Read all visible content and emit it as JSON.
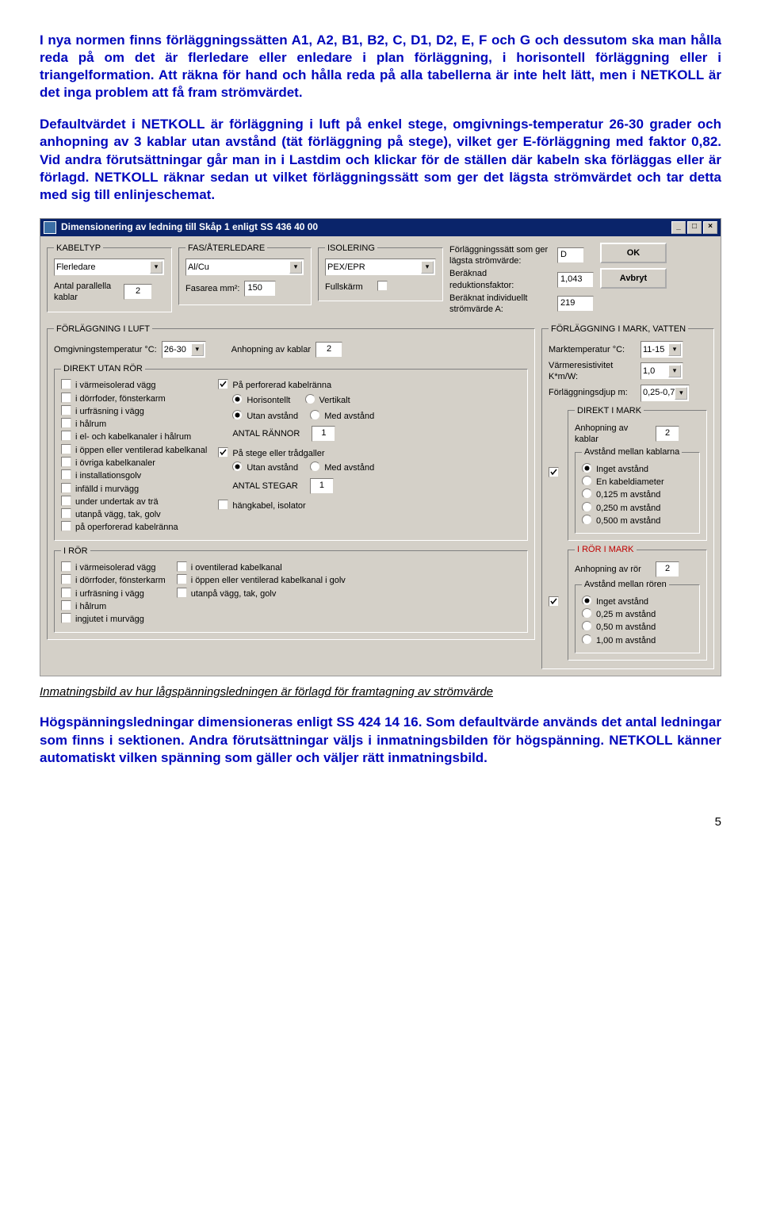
{
  "para1": "I nya normen finns förläggningssätten A1, A2, B1, B2, C, D1, D2, E, F och G och dessutom ska man hålla reda på om det är flerledare eller enledare i plan förläggning, i horisontell förläggning eller i triangelformation. Att räkna för hand och hålla reda på alla tabellerna är inte helt lätt, men i NETKOLL är det inga problem att få fram strömvärdet.",
  "para2": "Defaultvärdet i NETKOLL är förläggning i luft på enkel stege, omgivnings-temperatur 26-30 grader och anhopning av 3 kablar utan avstånd (tät förläggning på stege), vilket ger E-förläggning med faktor 0,82. Vid andra förutsättningar går man in i Lastdim och klickar för de ställen där kabeln ska förläggas eller är förlagd. NETKOLL räknar sedan ut vilket förläggningssätt som ger det lägsta strömvärdet och tar detta med sig till enlinjeschemat.",
  "win": {
    "title": "Dimensionering av ledning till Skåp 1 enligt SS 436 40 00",
    "kabeltyp": {
      "legend": "KABELTYP",
      "value": "Flerledare",
      "paraLbl": "Antal parallella kablar",
      "paraVal": "2"
    },
    "fas": {
      "legend": "FAS/ÅTERLEDARE",
      "value": "Al/Cu",
      "areaLbl": "Fasarea mm²:",
      "areaVal": "150"
    },
    "iso": {
      "legend": "ISOLERING",
      "value": "PEX/EPR",
      "fullLbl": "Fullskärm"
    },
    "res": {
      "l1": "Förläggningssätt som ger lägsta strömvärde:",
      "v1": "D",
      "l2": "Beräknad reduktionsfaktor:",
      "v2": "1,043",
      "l3": "Beräknat individuellt strömvärde A:",
      "v3": "219"
    },
    "ok": "OK",
    "avbryt": "Avbryt",
    "luft": {
      "legend": "FÖRLÄGGNING I LUFT",
      "tempLbl": "Omgivningstemperatur °C:",
      "tempVal": "26-30",
      "anhLbl": "Anhopning av kablar",
      "anhVal": "2",
      "direkt": {
        "legend": "DIREKT UTAN RÖR",
        "left": [
          "i värmeisolerad vägg",
          "i dörrfoder, fönsterkarm",
          "i urfräsning i vägg",
          "i hålrum",
          "i el- och kabelkanaler i hålrum",
          "i öppen eller ventilerad kabelkanal",
          "i övriga kabelkanaler",
          "i installationsgolv",
          "infälld i murvägg",
          "under undertak av trä",
          "utanpå vägg, tak, golv",
          "på operforerad kabelränna"
        ],
        "right": {
          "perf": "På perforerad kabelränna",
          "r1a": "Horisontellt",
          "r1b": "Vertikalt",
          "r2a": "Utan avstånd",
          "r2b": "Med avstånd",
          "rannorLbl": "ANTAL RÄNNOR",
          "rannorVal": "1",
          "stege": "På stege eller trådgaller",
          "r3a": "Utan avstånd",
          "r3b": "Med avstånd",
          "stegarLbl": "ANTAL STEGAR",
          "stegarVal": "1",
          "hang": "hängkabel, isolator"
        }
      },
      "ror": {
        "legend": "I RÖR",
        "left": [
          "i värmeisolerad vägg",
          "i dörrfoder, fönsterkarm",
          "i urfräsning i vägg",
          "i hålrum",
          "ingjutet i murvägg"
        ],
        "right": [
          "i oventilerad kabelkanal",
          "i öppen eller ventilerad kabelkanal i golv",
          "utanpå vägg, tak, golv"
        ]
      }
    },
    "mark": {
      "legend": "FÖRLÄGGNING I MARK, VATTEN",
      "tempLbl": "Marktemperatur °C:",
      "tempVal": "11-15",
      "resLbl": "Värmeresistivitet K*m/W:",
      "resVal": "1,0",
      "djupLbl": "Förläggningsdjup m:",
      "djupVal": "0,25-0,7",
      "direkt": {
        "legend": "DIREKT I MARK",
        "checked": true,
        "anhLbl": "Anhopning av kablar",
        "anhVal": "2",
        "avLbl": "Avstånd mellan kablarna",
        "opts": [
          "Inget avstånd",
          "En kabeldiameter",
          "0,125 m avstånd",
          "0,250 m avstånd",
          "0,500 m avstånd"
        ],
        "selIdx": 0
      },
      "ror": {
        "legend": "I RÖR I MARK",
        "checked": true,
        "anhLbl": "Anhopning av rör",
        "anhVal": "2",
        "avLbl": "Avstånd mellan rören",
        "opts": [
          "Inget avstånd",
          "0,25 m avstånd",
          "0,50 m avstånd",
          "1,00 m avstånd"
        ],
        "selIdx": 0
      }
    }
  },
  "caption": "Inmatningsbild av hur lågspänningsledningen är förlagd för framtagning av strömvärde",
  "para3": "Högspänningsledningar dimensioneras enligt SS 424 14 16. Som defaultvärde används det antal ledningar som finns i sektionen. Andra förutsättningar väljs i inmatningsbilden för högspänning. NETKOLL känner automatiskt vilken spänning som gäller och väljer rätt inmatningsbild.",
  "page": "5"
}
